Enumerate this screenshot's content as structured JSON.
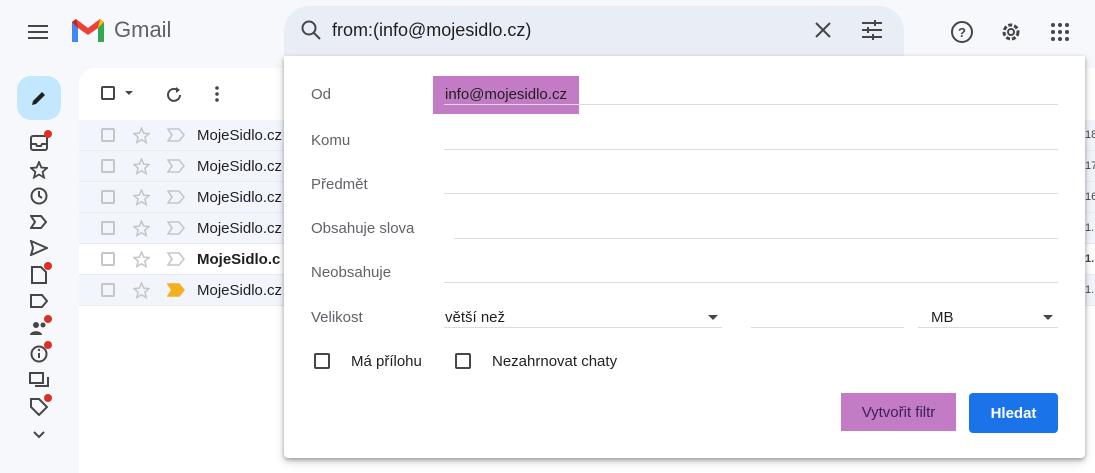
{
  "app": {
    "name": "Gmail"
  },
  "search": {
    "query": "from:(info@mojesidlo.cz)"
  },
  "icons": {
    "menu": "hamburger-menu-icon",
    "search": "search-icon",
    "clear": "close-icon",
    "tune": "search-options-icon",
    "help": "help-icon",
    "settings": "gear-icon",
    "apps": "apps-grid-icon"
  },
  "colors": {
    "highlight": "#c47bc6",
    "primary_button": "#1a73e8",
    "compose_bg": "#c2e7ff",
    "unread_dot": "#d93025"
  },
  "rail": {
    "items": [
      "inbox-icon",
      "star-icon",
      "clock-icon",
      "important-icon",
      "send-icon",
      "drafts-icon",
      "label-icon",
      "contacts-icon",
      "info-icon",
      "chat-icon",
      "tag-icon",
      "expand-icon"
    ]
  },
  "mail_list": {
    "rows": [
      {
        "sender": "MojeSidlo.cz",
        "date": "18",
        "unread": false,
        "important": false
      },
      {
        "sender": "MojeSidlo.cz",
        "date": "17",
        "unread": false,
        "important": false
      },
      {
        "sender": "MojeSidlo.cz",
        "date": "16",
        "unread": false,
        "important": false
      },
      {
        "sender": "MojeSidlo.cz",
        "date": "1.",
        "unread": false,
        "important": false
      },
      {
        "sender": "MojeSidlo.c",
        "date": "1.",
        "unread": true,
        "important": false
      },
      {
        "sender": "MojeSidlo.cz",
        "date": "1.",
        "unread": false,
        "important": true
      }
    ]
  },
  "panel": {
    "labels": {
      "from": "Od",
      "to": "Komu",
      "subject": "Předmět",
      "has_words": "Obsahuje slova",
      "doesnt_have": "Neobsahuje",
      "size": "Velikost"
    },
    "from_value": "info@mojesidlo.cz",
    "size_operator": "větší než",
    "size_unit": "MB",
    "has_attachment": "Má přílohu",
    "exclude_chats": "Nezahrnovat chaty",
    "create_filter": "Vytvořit filtr",
    "search_button": "Hledat"
  }
}
